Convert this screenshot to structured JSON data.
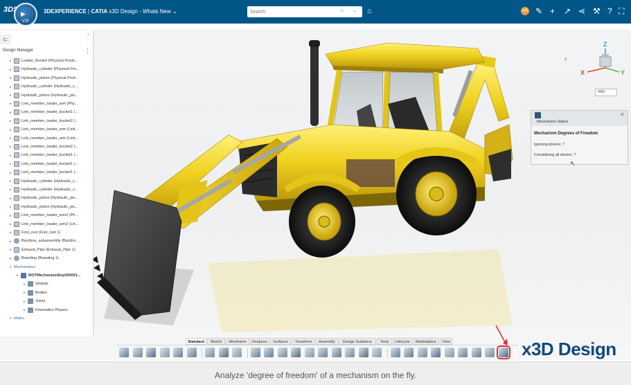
{
  "topbar": {
    "brand_logo": "3DS",
    "compass_mark": "▶",
    "compass_label": "V.R",
    "title_brand": "3DEXPERIENCE",
    "title_separator": " | ",
    "title_app_brand": "CATIA",
    "title_rest": " x3D Design - Whats New ⌄",
    "search_placeholder": "Search",
    "user_initials": "AR",
    "icons": [
      "tag-icon",
      "user-avatar",
      "bulb-icon",
      "plus-icon",
      "share-icon",
      "network-icon",
      "tools-icon",
      "help-icon",
      "expand-icon"
    ]
  },
  "tree": {
    "tab_icon": "⊏",
    "title": "Design Manager",
    "rows": [
      {
        "label": "Loader_Bucket (Physical Produ...",
        "icon": "prod",
        "indent": 0
      },
      {
        "label": "Hydraulic_cylinder (Physical Pro...",
        "icon": "prod",
        "indent": 0
      },
      {
        "label": "Hydraulic_piston (Physical Prod...",
        "icon": "prod",
        "indent": 0
      },
      {
        "label": "Hydraulic_cylinder (Hydraulic_c...",
        "icon": "prod",
        "indent": 0
      },
      {
        "label": "Hydraulic_piston (Hydraulic_pis...",
        "icon": "prod",
        "indent": 0
      },
      {
        "label": "Link_member_loader_arm (Phy...",
        "icon": "prod",
        "indent": 0
      },
      {
        "label": "Link_member_loader_bucket1 (...",
        "icon": "prod",
        "indent": 0
      },
      {
        "label": "Link_member_loader_bucket2 (...",
        "icon": "prod",
        "indent": 0
      },
      {
        "label": "Link_member_loader_arm (Link...",
        "icon": "prod",
        "indent": 0
      },
      {
        "label": "Link_member_loader_arm (Link...",
        "icon": "prod",
        "indent": 0
      },
      {
        "label": "Link_member_loader_bucket2 (...",
        "icon": "prod",
        "indent": 0
      },
      {
        "label": "Link_member_loader_bucket1 (...",
        "icon": "prod",
        "indent": 0
      },
      {
        "label": "Link_member_loader_bucket1 (...",
        "icon": "prod",
        "indent": 0
      },
      {
        "label": "Link_member_loader_bucket1 (...",
        "icon": "prod",
        "indent": 0
      },
      {
        "label": "Hydraulic_cylinder (Hydraulic_c...",
        "icon": "prod",
        "indent": 0
      },
      {
        "label": "Hydraulic_cylinder (Hydraulic_c...",
        "icon": "prod",
        "indent": 0
      },
      {
        "label": "Hydraulic_piston (Hydraulic_pis...",
        "icon": "prod",
        "indent": 0
      },
      {
        "label": "Hydraulic_piston (Hydraulic_pis...",
        "icon": "prod",
        "indent": 0
      },
      {
        "label": "Link_member_loader_arm2 (Ph...",
        "icon": "prod",
        "indent": 0
      },
      {
        "label": "Link_member_loader_arm2 (Lin...",
        "icon": "prod",
        "indent": 0
      },
      {
        "label": "Foot_rest (Foot_rest 1)",
        "icon": "prod",
        "indent": 0
      },
      {
        "label": "Backhoe_subassembly (Backho...",
        "icon": "gear",
        "indent": 0
      },
      {
        "label": "Exhaust_Pipe (Exhaust_Pipe 1)",
        "icon": "prod",
        "indent": 0
      },
      {
        "label": "Branding (Branding 1)",
        "icon": "gear",
        "indent": 0
      },
      {
        "label": "Mechanisms",
        "icon": "none",
        "indent": 0,
        "blue": true
      },
      {
        "label": "MOTMechanismRep000001...",
        "icon": "mech",
        "indent": 1,
        "bold": true
      },
      {
        "label": "Globals",
        "icon": "folder",
        "indent": 2
      },
      {
        "label": "Bodies",
        "icon": "folder",
        "indent": 2
      },
      {
        "label": "Joints",
        "icon": "folder",
        "indent": 2
      },
      {
        "label": "Kinematics Players",
        "icon": "folder",
        "indent": 2
      },
      {
        "label": "Mates",
        "icon": "none",
        "indent": 0,
        "blue": true
      }
    ]
  },
  "viewport": {
    "units_value": "mm",
    "axis_x": "X",
    "axis_y": "Y",
    "axis_z": "Z"
  },
  "mechanism_status": {
    "title": "Mechanism Status",
    "heading": "Mechanism Degrees of Freedom",
    "line1": "Ignoring drivers: 7",
    "line2": "Considering all drivers: 7"
  },
  "action_bar": {
    "tabs": [
      "Standard",
      "Sketch",
      "Wireframe",
      "Features",
      "Surfaces",
      "Transform",
      "Assembly",
      "Design Guidance",
      "Tools",
      "Lifecycle",
      "Marketplace",
      "View"
    ],
    "active_tab": "Standard"
  },
  "brand_overlay": "x3D Design",
  "caption": "Analyze 'degree of freedom' of a mechanism on the fly.",
  "colors": {
    "topbar": "#005686",
    "accent_red": "#d9333a",
    "machine_yellow": "#f0d21e",
    "brand_blue": "#0f4a7b"
  }
}
